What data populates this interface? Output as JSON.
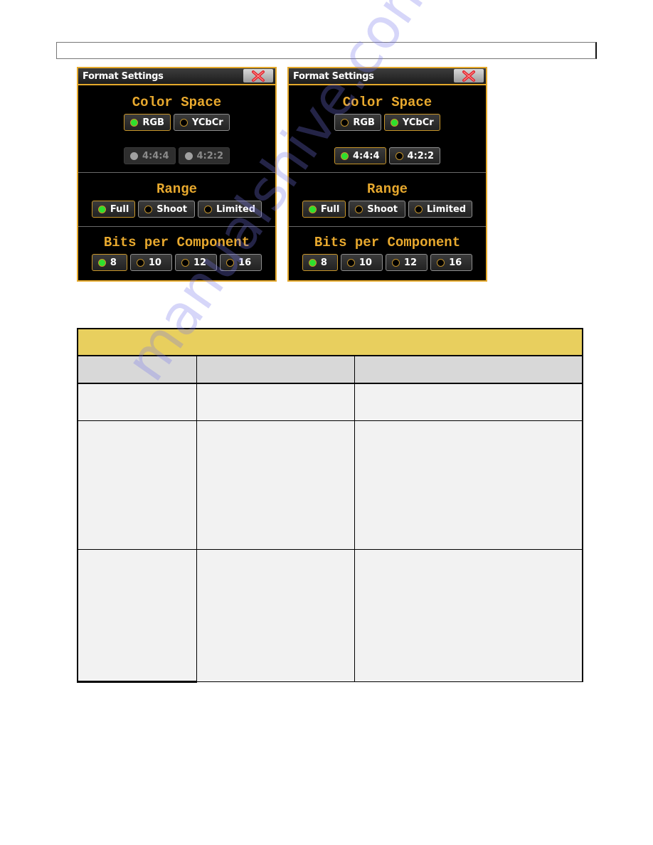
{
  "page": {
    "header_box_text": ""
  },
  "panels": [
    {
      "title": "Format Settings",
      "close_icon": "close-x-icon",
      "color_space": {
        "heading": "Color Space",
        "options": [
          {
            "label": "RGB",
            "state": "selected"
          },
          {
            "label": "YCbCr",
            "state": "unselected"
          }
        ],
        "sampling": [
          {
            "label": "4:4:4",
            "state": "disabled"
          },
          {
            "label": "4:2:2",
            "state": "disabled"
          }
        ]
      },
      "range": {
        "heading": "Range",
        "options": [
          {
            "label": "Full",
            "state": "selected"
          },
          {
            "label": "Shoot",
            "state": "unselected"
          },
          {
            "label": "Limited",
            "state": "unselected"
          }
        ]
      },
      "bits": {
        "heading": "Bits per Component",
        "options": [
          {
            "label": "8",
            "state": "selected"
          },
          {
            "label": "10",
            "state": "unselected"
          },
          {
            "label": "12",
            "state": "unselected"
          },
          {
            "label": "16",
            "state": "unselected"
          }
        ]
      }
    },
    {
      "title": "Format Settings",
      "close_icon": "close-x-icon",
      "color_space": {
        "heading": "Color Space",
        "options": [
          {
            "label": "RGB",
            "state": "unselected"
          },
          {
            "label": "YCbCr",
            "state": "selected"
          }
        ],
        "sampling": [
          {
            "label": "4:4:4",
            "state": "selected"
          },
          {
            "label": "4:2:2",
            "state": "unselected"
          }
        ]
      },
      "range": {
        "heading": "Range",
        "options": [
          {
            "label": "Full",
            "state": "selected"
          },
          {
            "label": "Shoot",
            "state": "unselected"
          },
          {
            "label": "Limited",
            "state": "unselected"
          }
        ]
      },
      "bits": {
        "heading": "Bits per Component",
        "options": [
          {
            "label": "8",
            "state": "selected"
          },
          {
            "label": "10",
            "state": "unselected"
          },
          {
            "label": "12",
            "state": "unselected"
          },
          {
            "label": "16",
            "state": "unselected"
          }
        ]
      }
    }
  ],
  "table": {
    "caption": "",
    "headers": [
      "",
      "",
      ""
    ],
    "rows": [
      [
        "",
        "",
        ""
      ],
      [
        "",
        "",
        ""
      ],
      [
        "",
        "",
        ""
      ]
    ]
  },
  "watermark": "manualshive.com",
  "colors": {
    "accent_gold": "#e5a92b",
    "selected_green": "#2ee02e",
    "table_caption_yellow": "#e8cf5e",
    "table_header_gray": "#d8d8d8",
    "table_cell_gray": "#f2f2f2"
  }
}
